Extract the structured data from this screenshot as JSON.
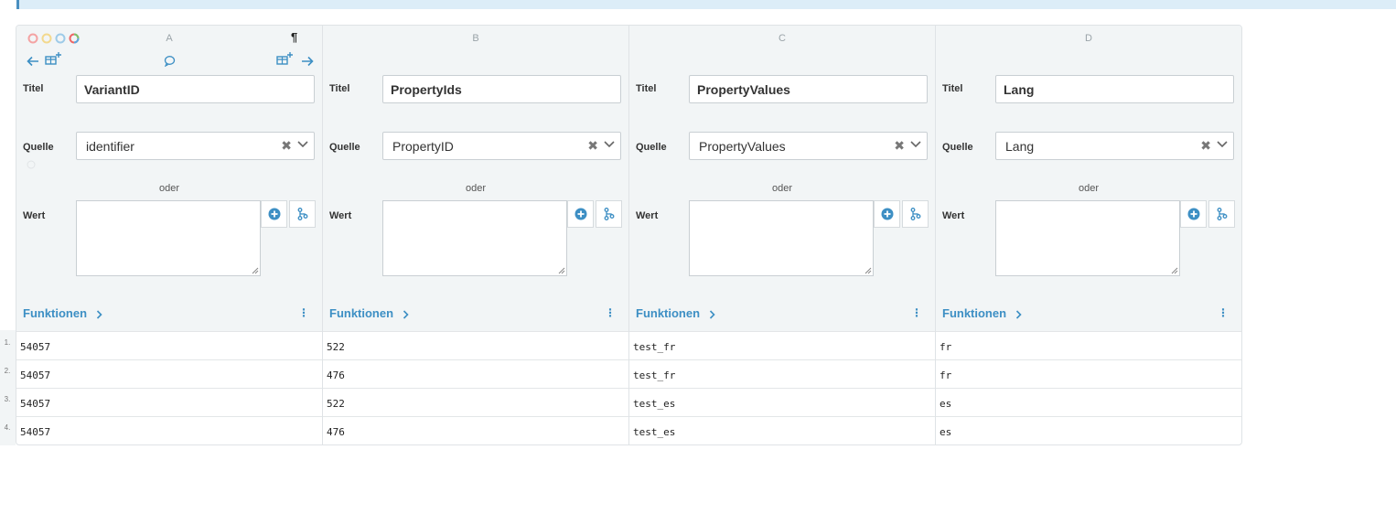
{
  "labels": {
    "titel": "Titel",
    "quelle": "Quelle",
    "wert": "Wert",
    "oder": "oder",
    "funktionen": "Funktionen",
    "paragraph": "¶"
  },
  "columns": [
    {
      "letter": "A",
      "title": "VariantID",
      "source": "identifier"
    },
    {
      "letter": "B",
      "title": "PropertyIds",
      "source": "PropertyID"
    },
    {
      "letter": "C",
      "title": "PropertyValues",
      "source": "PropertyValues"
    },
    {
      "letter": "D",
      "title": "Lang",
      "source": "Lang"
    }
  ],
  "rows": [
    {
      "num": "1.",
      "cells": [
        "54057",
        "522",
        "test_fr",
        "fr"
      ]
    },
    {
      "num": "2.",
      "cells": [
        "54057",
        "476",
        "test_fr",
        "fr"
      ]
    },
    {
      "num": "3.",
      "cells": [
        "54057",
        "522",
        "test_es",
        "es"
      ]
    },
    {
      "num": "4.",
      "cells": [
        "54057",
        "476",
        "test_es",
        "es"
      ]
    }
  ],
  "colors": {
    "accent": "#3d8fc4",
    "header_bg": "#f2f5f6",
    "dot_red": "#f4a3a3",
    "dot_yellow": "#f3d98e",
    "dot_blue": "#9ecbe8"
  },
  "icons": [
    "window-dots-icon",
    "arrow-left-icon",
    "add-column-icon",
    "comment-icon",
    "arrow-right-icon",
    "clear-icon",
    "chevron-down-icon",
    "add-circle-icon",
    "branch-icon",
    "more-vertical-icon"
  ]
}
